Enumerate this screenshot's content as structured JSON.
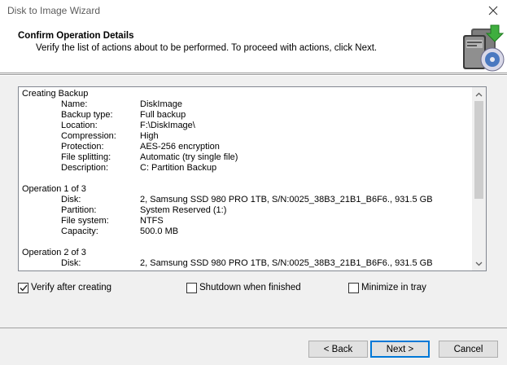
{
  "window": {
    "title": "Disk to Image Wizard"
  },
  "header": {
    "title": "Confirm Operation Details",
    "subtitle": "Verify the list of actions about to be performed. To proceed with actions, click Next.",
    "icon": "disk-image-wizard-icon"
  },
  "details": {
    "sections": [
      {
        "title": "Creating Backup",
        "rows": [
          {
            "key": "Name:",
            "value": "DiskImage"
          },
          {
            "key": "Backup type:",
            "value": "Full backup"
          },
          {
            "key": "Location:",
            "value": "F:\\DiskImage\\"
          },
          {
            "key": "Compression:",
            "value": "High"
          },
          {
            "key": "Protection:",
            "value": "AES-256 encryption"
          },
          {
            "key": "File splitting:",
            "value": "Automatic (try single file)"
          },
          {
            "key": "Description:",
            "value": "C: Partition Backup"
          }
        ]
      },
      {
        "title": "Operation 1 of 3",
        "rows": [
          {
            "key": "Disk:",
            "value": "2, Samsung SSD 980 PRO 1TB, S/N:0025_38B3_21B1_B6F6., 931.5 GB"
          },
          {
            "key": "Partition:",
            "value": "System Reserved (1:)"
          },
          {
            "key": "File system:",
            "value": "NTFS"
          },
          {
            "key": "Capacity:",
            "value": "500.0 MB"
          }
        ]
      },
      {
        "title": "Operation 2 of 3",
        "rows": [
          {
            "key": "Disk:",
            "value": "2, Samsung SSD 980 PRO 1TB, S/N:0025_38B3_21B1_B6F6., 931.5 GB"
          }
        ]
      }
    ]
  },
  "options": {
    "verify": {
      "label": "Verify after creating",
      "checked": true
    },
    "shutdown": {
      "label": "Shutdown when finished",
      "checked": false
    },
    "minimize": {
      "label": "Minimize in tray",
      "checked": false
    }
  },
  "buttons": {
    "back": "< Back",
    "next": "Next >",
    "cancel": "Cancel"
  },
  "colors": {
    "accent": "#0078d7",
    "dialog_bg": "#f0f0f0",
    "header_bg": "#ffffff"
  }
}
